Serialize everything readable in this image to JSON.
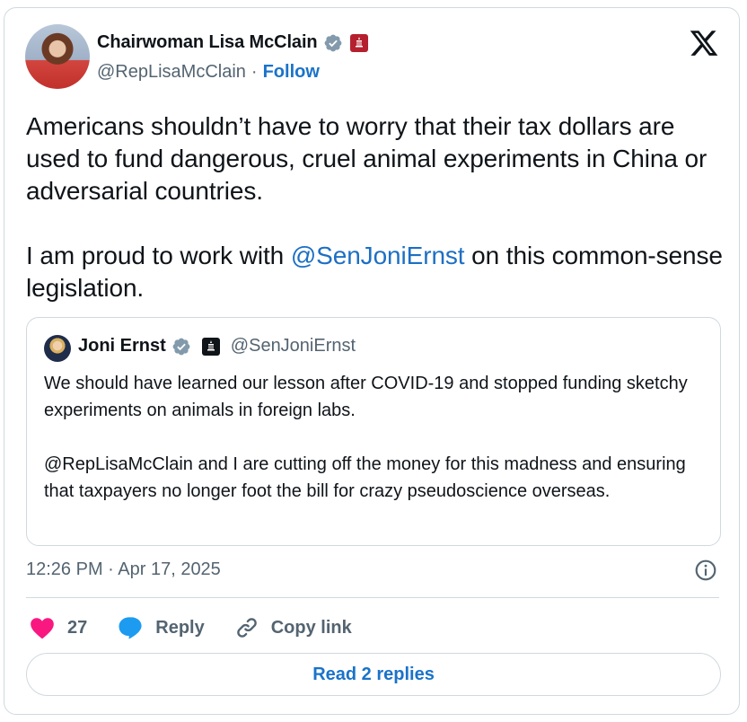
{
  "author": {
    "display_name": "Chairwoman Lisa McClain",
    "handle": "@RepLisaMcClain",
    "separator": "·",
    "follow_label": "Follow"
  },
  "tweet": {
    "text_part1": "Americans shouldn’t have to worry that their tax dollars are used to fund dangerous, cruel animal experiments in China or adversarial countries.\n\nI am proud to work with ",
    "mention": "@SenJoniErnst",
    "text_part2": " on this common-sense legislation."
  },
  "quote": {
    "display_name": "Joni Ernst",
    "handle": "@SenJoniErnst",
    "text": "We should have learned our lesson after COVID-19 and stopped funding sketchy experiments on animals in foreign labs.\n\n@RepLisaMcClain and I are cutting off the money for this madness and ensuring that taxpayers no longer foot the bill for crazy pseudoscience overseas."
  },
  "meta": {
    "timestamp": "12:26 PM · Apr 17, 2025"
  },
  "actions": {
    "like_count": "27",
    "reply_label": "Reply",
    "copy_link_label": "Copy link"
  },
  "read_replies_label": "Read 2 replies",
  "colors": {
    "accent": "#1a73c9",
    "like": "#f91880",
    "reply": "#1d9bf0",
    "secondary_text": "#536471",
    "border": "#cfd9de"
  },
  "icons": [
    "verified-badge-icon",
    "government-badge-icon",
    "x-logo-icon",
    "info-icon",
    "heart-icon",
    "reply-bubble-icon",
    "link-icon"
  ]
}
